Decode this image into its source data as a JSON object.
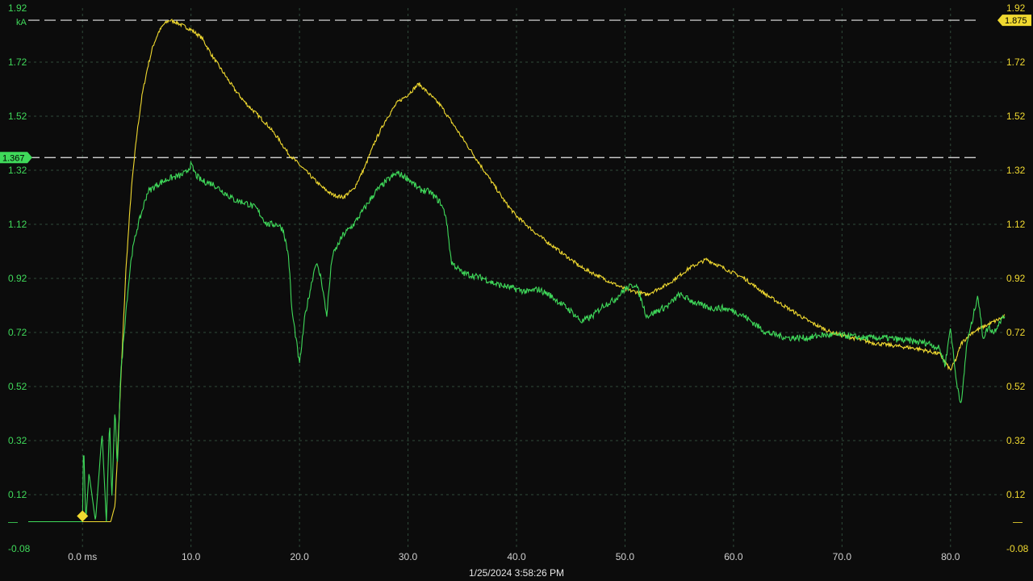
{
  "chart_data": {
    "type": "line",
    "xlabel": "ms",
    "ylabel": "kA",
    "xlim": [
      -5,
      85
    ],
    "ylim": [
      -0.08,
      1.92
    ],
    "x_ticks": [
      0,
      10,
      20,
      30,
      40,
      50,
      60,
      70,
      80
    ],
    "x_tick_labels": [
      "0.0 ms",
      "10.0",
      "20.0",
      "30.0",
      "40.0",
      "50.0",
      "60.0",
      "70.0",
      "80.0"
    ],
    "y_ticks": [
      -0.08,
      0.12,
      0.32,
      0.52,
      0.72,
      0.92,
      1.12,
      1.32,
      1.52,
      1.72,
      1.92
    ],
    "y_tick_labels": [
      "-0.08",
      "0.12",
      "0.32",
      "0.52",
      "0.72",
      "0.92",
      "1.12",
      "1.32",
      "1.52",
      "1.72",
      "1.92"
    ],
    "zero_tick_label": "—",
    "unit": "kA",
    "grid": true,
    "trigger_marker": {
      "x": 0,
      "y": 0.02
    },
    "cursors": [
      {
        "value": 1.875,
        "label": "1.875",
        "color": "#f0d930",
        "side": "right"
      },
      {
        "value": 1.367,
        "label": "1.367",
        "color": "#3fd95a",
        "side": "left"
      }
    ],
    "series": [
      {
        "color": "#f0d930",
        "x": [
          -5,
          0,
          1.5,
          2.6,
          3.0,
          3.2,
          3.6,
          4.0,
          4.5,
          5.0,
          5.5,
          6.0,
          6.5,
          7.0,
          7.5,
          8.0,
          8.5,
          9.0,
          9.5,
          10,
          11,
          12,
          13,
          14,
          15,
          16,
          17,
          18,
          19,
          20,
          21,
          22,
          23,
          24,
          25,
          26,
          27,
          28,
          29,
          30,
          31,
          32,
          33,
          34,
          35,
          36,
          37,
          38,
          39,
          40,
          42,
          44,
          46,
          48,
          50,
          52,
          54,
          56,
          57.5,
          59,
          61,
          63,
          65,
          67,
          69,
          71,
          73,
          75,
          77,
          79,
          79.5,
          80,
          80.5,
          81,
          82,
          83,
          84,
          85
        ],
        "y": [
          0.02,
          0.02,
          0.02,
          0.02,
          0.08,
          0.25,
          0.6,
          0.95,
          1.25,
          1.45,
          1.6,
          1.7,
          1.78,
          1.83,
          1.86,
          1.875,
          1.87,
          1.86,
          1.85,
          1.84,
          1.81,
          1.74,
          1.68,
          1.62,
          1.57,
          1.53,
          1.49,
          1.44,
          1.38,
          1.34,
          1.3,
          1.26,
          1.23,
          1.22,
          1.25,
          1.33,
          1.43,
          1.51,
          1.57,
          1.6,
          1.64,
          1.6,
          1.56,
          1.5,
          1.44,
          1.38,
          1.32,
          1.26,
          1.2,
          1.15,
          1.08,
          1.02,
          0.96,
          0.92,
          0.88,
          0.86,
          0.9,
          0.96,
          0.99,
          0.96,
          0.92,
          0.86,
          0.81,
          0.76,
          0.72,
          0.7,
          0.68,
          0.67,
          0.66,
          0.64,
          0.61,
          0.58,
          0.62,
          0.68,
          0.72,
          0.74,
          0.76,
          0.78
        ]
      },
      {
        "color": "#3fd95a",
        "x": [
          -5,
          0,
          0.1,
          0.3,
          0.6,
          1.2,
          1.8,
          2.2,
          2.5,
          2.7,
          3.0,
          3.2,
          3.5,
          4.0,
          4.5,
          5.0,
          5.5,
          6.0,
          7,
          8,
          9,
          9.5,
          10,
          10.5,
          11,
          12,
          13,
          14,
          15,
          16,
          17,
          18,
          18.5,
          19,
          19.3,
          19.6,
          20,
          20.5,
          21,
          21.5,
          22,
          22.5,
          23,
          24,
          25,
          26,
          27,
          28,
          29,
          30,
          31,
          32,
          33,
          33.5,
          34,
          35,
          36,
          37,
          38,
          39,
          40,
          41,
          42,
          43,
          44,
          45,
          46,
          47,
          48,
          49,
          50,
          51,
          52,
          53,
          54,
          55,
          56,
          57,
          58,
          59,
          60,
          61,
          62,
          63,
          64,
          65,
          66,
          67,
          68,
          69,
          70,
          72,
          74,
          76,
          78,
          79,
          79.5,
          80,
          80.5,
          81,
          81.5,
          82,
          82.5,
          83,
          83.5,
          84,
          84.5,
          85
        ],
        "y": [
          0.02,
          0.02,
          0.33,
          0.02,
          0.2,
          0.02,
          0.35,
          0.02,
          0.4,
          0.1,
          0.45,
          0.2,
          0.55,
          0.8,
          1.0,
          1.1,
          1.17,
          1.24,
          1.27,
          1.29,
          1.3,
          1.31,
          1.34,
          1.3,
          1.28,
          1.27,
          1.24,
          1.21,
          1.2,
          1.18,
          1.12,
          1.12,
          1.1,
          1.0,
          0.8,
          0.72,
          0.6,
          0.78,
          0.88,
          0.98,
          0.92,
          0.78,
          1.0,
          1.08,
          1.12,
          1.18,
          1.24,
          1.28,
          1.31,
          1.29,
          1.25,
          1.24,
          1.2,
          1.15,
          0.98,
          0.94,
          0.93,
          0.92,
          0.9,
          0.89,
          0.88,
          0.87,
          0.88,
          0.86,
          0.83,
          0.8,
          0.76,
          0.78,
          0.82,
          0.84,
          0.88,
          0.9,
          0.78,
          0.8,
          0.82,
          0.86,
          0.84,
          0.82,
          0.81,
          0.81,
          0.8,
          0.78,
          0.75,
          0.72,
          0.71,
          0.7,
          0.7,
          0.7,
          0.71,
          0.71,
          0.71,
          0.7,
          0.7,
          0.69,
          0.68,
          0.66,
          0.6,
          0.74,
          0.55,
          0.45,
          0.68,
          0.76,
          0.86,
          0.7,
          0.74,
          0.72,
          0.76,
          0.78
        ]
      }
    ]
  },
  "footer": {
    "timestamp": "1/25/2024 3:58:26 PM"
  }
}
